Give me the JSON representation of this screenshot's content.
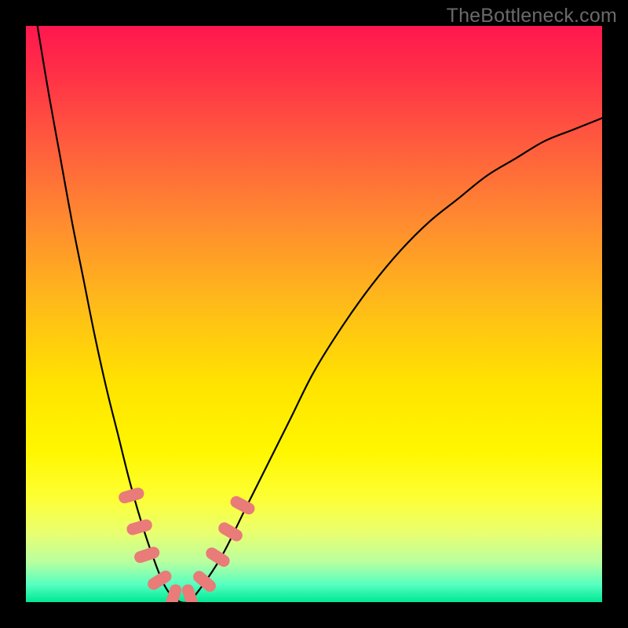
{
  "watermark": "TheBottleneck.com",
  "chart_data": {
    "type": "line",
    "title": "",
    "xlabel": "",
    "ylabel": "",
    "xlim": [
      0,
      100
    ],
    "ylim": [
      0,
      100
    ],
    "series": [
      {
        "name": "bottleneck-curve",
        "x": [
          2,
          4,
          6,
          8,
          10,
          12,
          14,
          16,
          18,
          20,
          22,
          24,
          26,
          28,
          30,
          34,
          38,
          42,
          46,
          50,
          55,
          60,
          65,
          70,
          75,
          80,
          85,
          90,
          95,
          100
        ],
        "y": [
          100,
          88,
          77,
          66,
          56,
          46,
          37,
          29,
          21,
          14,
          8,
          3,
          0.5,
          0,
          2,
          8,
          16,
          24,
          32,
          40,
          48,
          55,
          61,
          66,
          70,
          74,
          77,
          80,
          82,
          84
        ]
      }
    ],
    "markers": [
      {
        "name": "marker-a",
        "x": 18.3,
        "y": 18.5,
        "angle": 74
      },
      {
        "name": "marker-b",
        "x": 19.7,
        "y": 13.0,
        "angle": 74
      },
      {
        "name": "marker-c",
        "x": 21.0,
        "y": 8.2,
        "angle": 72
      },
      {
        "name": "marker-d",
        "x": 23.2,
        "y": 3.8,
        "angle": 58
      },
      {
        "name": "marker-e",
        "x": 25.6,
        "y": 0.9,
        "angle": 18
      },
      {
        "name": "marker-f",
        "x": 28.5,
        "y": 0.9,
        "angle": -18
      },
      {
        "name": "marker-g",
        "x": 31.0,
        "y": 3.6,
        "angle": -50
      },
      {
        "name": "marker-h",
        "x": 33.3,
        "y": 7.8,
        "angle": -58
      },
      {
        "name": "marker-i",
        "x": 35.5,
        "y": 12.2,
        "angle": -60
      },
      {
        "name": "marker-j",
        "x": 37.6,
        "y": 16.8,
        "angle": -62
      }
    ],
    "gradient_stops": [
      {
        "pos": 0.0,
        "color": "#ff174e"
      },
      {
        "pos": 0.62,
        "color": "#ffe300"
      },
      {
        "pos": 1.0,
        "color": "#00e893"
      }
    ]
  }
}
